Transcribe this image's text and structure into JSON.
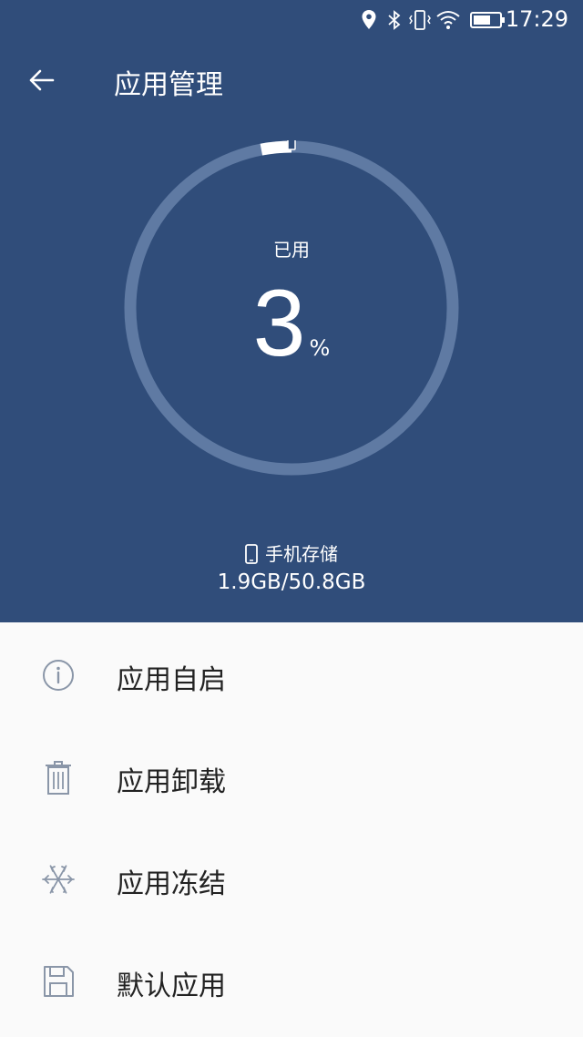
{
  "status_bar": {
    "time": "17:29",
    "icons": [
      "location-icon",
      "bluetooth-icon",
      "vibrate-icon",
      "wifi-icon",
      "battery-icon"
    ]
  },
  "app_bar": {
    "title": "应用管理",
    "back_icon": "back-arrow-icon"
  },
  "storage": {
    "used_label": "已用",
    "percent_value": "3",
    "percent_sign": "%",
    "used_fraction": 0.03,
    "storage_name": "手机存储",
    "storage_value": "1.9GB/50.8GB"
  },
  "menu": {
    "items": [
      {
        "label": "应用自启",
        "icon": "info-icon"
      },
      {
        "label": "应用卸载",
        "icon": "trash-icon"
      },
      {
        "label": "应用冻结",
        "icon": "snowflake-icon"
      },
      {
        "label": "默认应用",
        "icon": "save-icon"
      }
    ]
  },
  "colors": {
    "header_bg": "#304d7a",
    "ring_track": "#5f7aa3",
    "ring_fill": "#ffffff",
    "icon_gray": "#8a96a8"
  }
}
